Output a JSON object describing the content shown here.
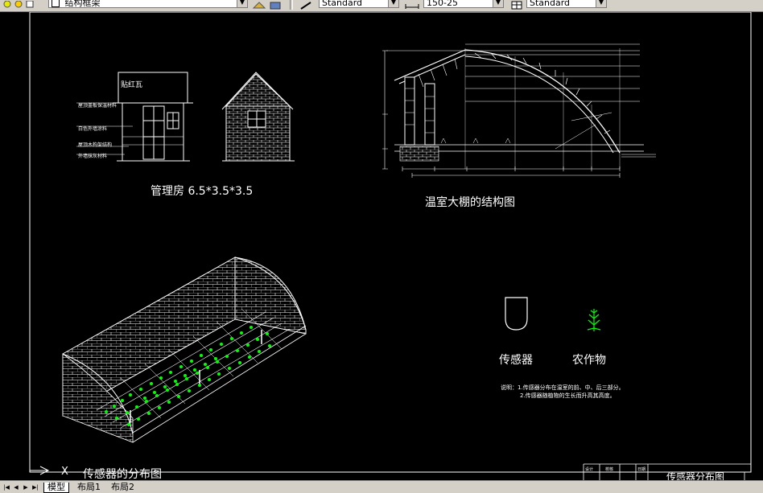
{
  "toolbar": {
    "layer_combo": "结构框架",
    "text_style": "Standard",
    "dim_scale": "150-25",
    "table_style": "Standard"
  },
  "drawings": {
    "house_caption": "管理房 6.5*3.5*3.5",
    "house_sign": "贴红瓦",
    "house_notes": [
      "屋顶盖板保温材料",
      "白色外墙涂料",
      "屋顶木构架结构",
      "外墙抹灰材料"
    ],
    "greenhouse_caption": "温室大棚的结构图",
    "sensor_caption": "传感器的分布图",
    "legend_sensor": "传感器",
    "legend_crop": "农作物",
    "note_1": "说明：1.传感器分布在温室的前、中、后三部分。",
    "note_2": "2.传感器随植物的生长而升高其高度。"
  },
  "title_block": {
    "drawing_name": "传感器分布图",
    "designer_label": "设计",
    "checker_label": "校核",
    "date_label": "日期"
  },
  "axis_label": "X",
  "tabs": [
    "模型",
    "布局1",
    "布局2"
  ],
  "colors": {
    "line": "#ffffff",
    "crop": "#00ff00",
    "background": "#000000",
    "chrome": "#d4d0c8"
  }
}
